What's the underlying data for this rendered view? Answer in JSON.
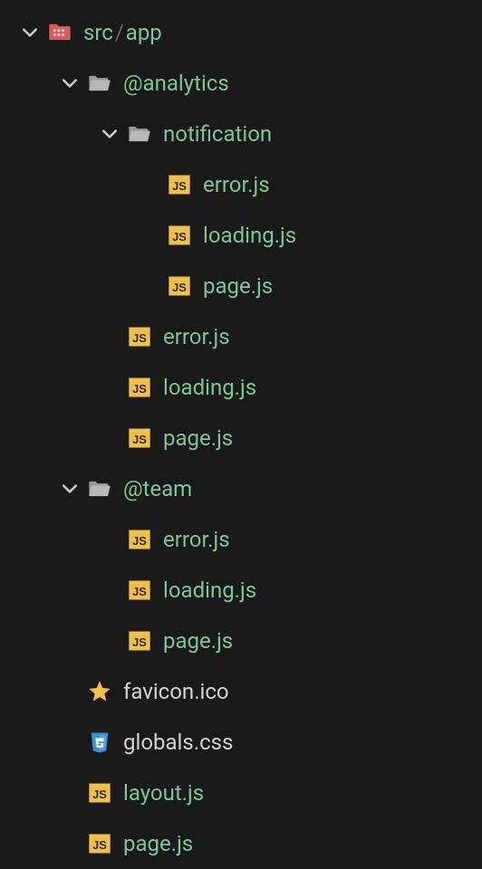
{
  "root": {
    "prefix": "src",
    "sep": "/",
    "name": "app"
  },
  "items": {
    "analytics": "@analytics",
    "notification": "notification",
    "error": "error.js",
    "loading": "loading.js",
    "page": "page.js",
    "team": "@team",
    "favicon": "favicon.ico",
    "globals": "globals.css",
    "layout": "layout.js"
  },
  "indent": {
    "l0": 0,
    "l1": 44,
    "l2": 88,
    "l3": 132
  },
  "colors": {
    "green": "#7fc598",
    "jsYellow": "#f0c04b",
    "folderGray": "#b8b8b8",
    "rootRed": "#e05a5a",
    "cssBlue": "#3a8fd8",
    "starYellow": "#f0c04b"
  }
}
